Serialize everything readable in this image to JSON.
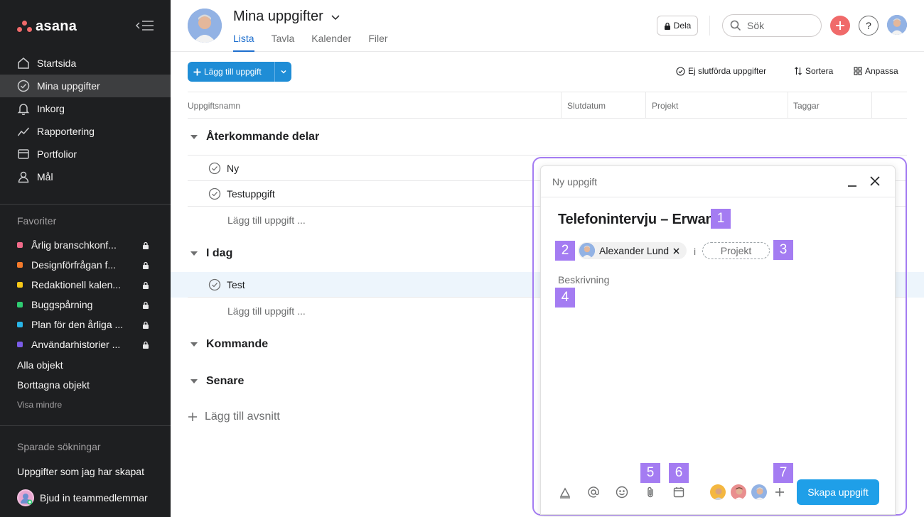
{
  "app": {
    "name": "asana"
  },
  "sidebar": {
    "nav": [
      {
        "label": "Startsida",
        "icon": "home-icon"
      },
      {
        "label": "Mina uppgifter",
        "icon": "check-circle-icon",
        "active": true
      },
      {
        "label": "Inkorg",
        "icon": "bell-icon"
      },
      {
        "label": "Rapportering",
        "icon": "chart-line-icon"
      },
      {
        "label": "Portfolior",
        "icon": "folder-icon"
      },
      {
        "label": "Mål",
        "icon": "person-icon"
      }
    ],
    "favorites_heading": "Favoriter",
    "favorites": [
      {
        "label": "Årlig branschkonf...",
        "color": "#f06a8a"
      },
      {
        "label": "Designförfrågan f...",
        "color": "#f47a2b"
      },
      {
        "label": "Redaktionell kalen...",
        "color": "#f8c817"
      },
      {
        "label": "Buggspårning",
        "color": "#2ecc71"
      },
      {
        "label": "Plan för den årliga ...",
        "color": "#28b5e8"
      },
      {
        "label": "Användarhistorier ...",
        "color": "#7b5ce8"
      }
    ],
    "all_objects": "Alla objekt",
    "deleted_objects": "Borttagna objekt",
    "show_less": "Visa mindre",
    "saved_searches_heading": "Sparade sökningar",
    "saved_search_item": "Uppgifter som jag har skapat",
    "invite_label": "Bjud in teammedlemmar"
  },
  "header": {
    "title": "Mina uppgifter",
    "tabs": [
      "Lista",
      "Tavla",
      "Kalender",
      "Filer"
    ],
    "share_label": "Dela",
    "search_placeholder": "Sök",
    "help_label": "?"
  },
  "toolbar": {
    "add_task_label": "Lägg till uppgift",
    "filter_label": "Ej slutförda uppgifter",
    "sort_label": "Sortera",
    "customize_label": "Anpassa"
  },
  "columns": [
    "Uppgiftsnamn",
    "Slutdatum",
    "Projekt",
    "Taggar"
  ],
  "sections": [
    {
      "title": "Återkommande delar",
      "tasks": [
        "Ny",
        "Testuppgift"
      ],
      "add_label": "Lägg till uppgift ..."
    },
    {
      "title": "I dag",
      "tasks": [
        "Test"
      ],
      "add_label": "Lägg till uppgift ..."
    },
    {
      "title": "Kommande",
      "tasks": []
    },
    {
      "title": "Senare",
      "tasks": []
    }
  ],
  "add_section_label": "Lägg till avsnitt",
  "new_task_modal": {
    "title": "Ny uppgift",
    "task_name": "Telefonintervju – Erwan",
    "assignee": "Alexander Lund",
    "in_label": "i",
    "project_placeholder": "Projekt",
    "description_placeholder": "Beskrivning",
    "create_label": "Skapa uppgift",
    "footer_icons": [
      "text-format-icon",
      "mention-icon",
      "emoji-icon",
      "attachment-icon",
      "calendar-icon"
    ]
  },
  "annotations": [
    "1",
    "2",
    "3",
    "4",
    "5",
    "6",
    "7"
  ],
  "colors": {
    "accent": "#1e6fce",
    "button": "#1f8dd6",
    "annotation": "#a47cf2",
    "sidebar_bg": "#1e1f21",
    "brand": "#f06a6a"
  }
}
